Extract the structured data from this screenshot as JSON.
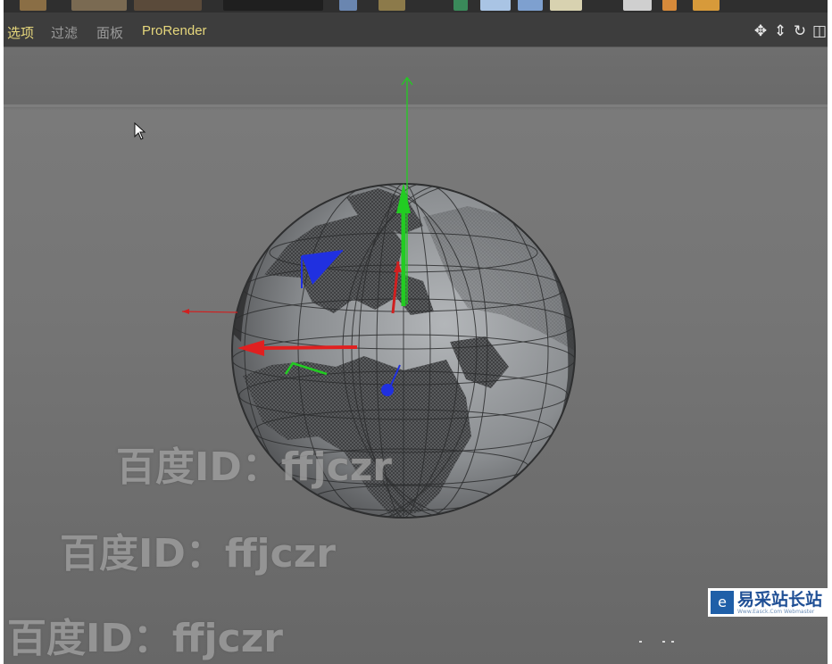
{
  "menu": {
    "items": [
      {
        "label": "选项"
      },
      {
        "label": "过滤"
      },
      {
        "label": "面板"
      },
      {
        "label": "ProRender"
      }
    ]
  },
  "nav": {
    "move_icon": "✥",
    "zoom_icon": "⇕",
    "rotate_icon": "↻",
    "layout_icon": "◫"
  },
  "watermarks": [
    {
      "text": "百度ID：ffjczr"
    },
    {
      "text": "百度ID：ffjczr"
    },
    {
      "text": "百度ID：ffjczr"
    }
  ],
  "brand": {
    "name": "易采站长站",
    "url": "Www.Easck.Com Webmaster",
    "logo_char": "e"
  },
  "colors": {
    "menu_active": "#e6d77c",
    "menu_inactive": "#9a9a9a",
    "axis_x": "#e02020",
    "axis_y": "#22cc22",
    "axis_z": "#2030e0",
    "viewport_bg": "#707070"
  }
}
